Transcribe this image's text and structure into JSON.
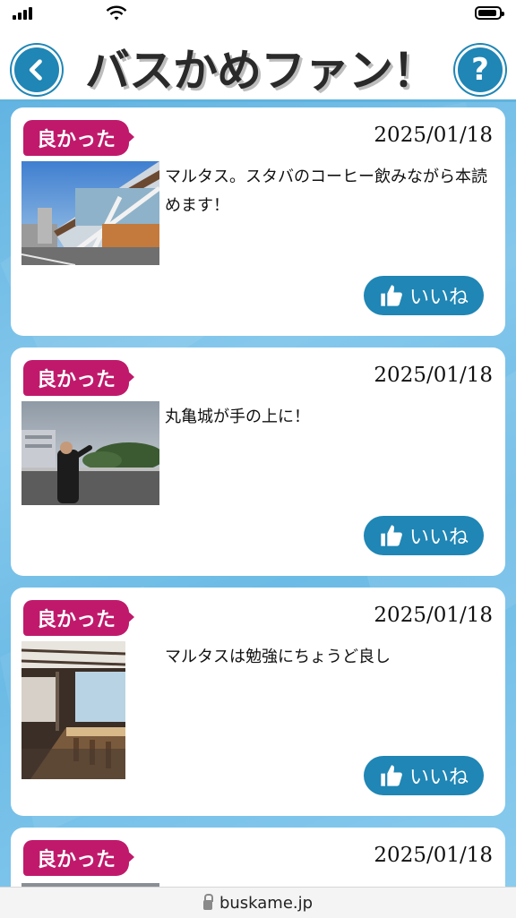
{
  "header": {
    "title": "バスかめファン！",
    "back_icon": "chevron-left-icon",
    "help_label": "?"
  },
  "posts": [
    {
      "tag": "良かった",
      "date": "2025/01/18",
      "text": "マルタス。スタバのコーヒー飲みながら本読めます！",
      "like_label": "いいね"
    },
    {
      "tag": "良かった",
      "date": "2025/01/18",
      "text": "丸亀城が手の上に！",
      "like_label": "いいね"
    },
    {
      "tag": "良かった",
      "date": "2025/01/18",
      "text": "マルタスは勉強にちょうど良し",
      "like_label": "いいね"
    },
    {
      "tag": "良かった",
      "date": "2025/01/18"
    }
  ],
  "browser": {
    "url": "buskame.jp"
  },
  "colors": {
    "accent": "#1f86b5",
    "tag": "#c0196b",
    "background": "#6cbbe6"
  }
}
